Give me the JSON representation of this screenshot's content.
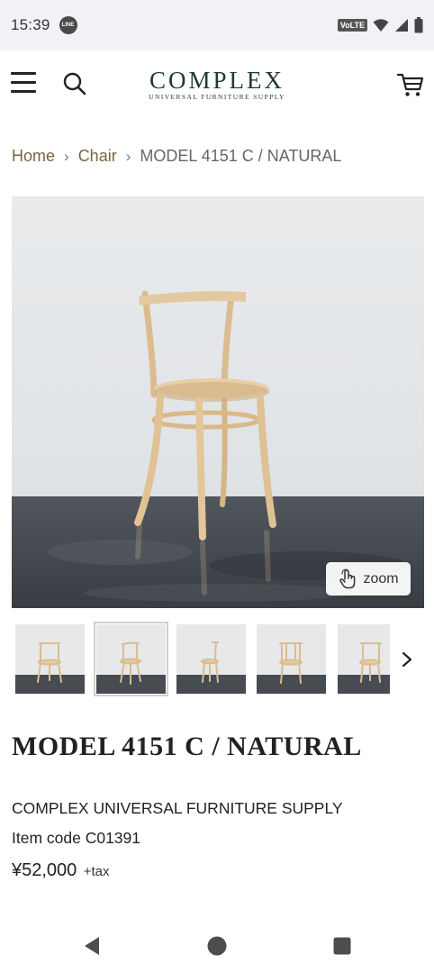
{
  "status_bar": {
    "time": "15:39",
    "line_badge": "LINE",
    "volte": "VoLTE"
  },
  "header": {
    "logo_main": "COMPLEX",
    "logo_sub": "UNIVERSAL FURNITURE SUPPLY"
  },
  "breadcrumb": {
    "items": [
      "Home",
      "Chair"
    ],
    "separator": "›",
    "current": "MODEL 4151 C / NATURAL"
  },
  "gallery": {
    "zoom_label": "zoom",
    "thumbnail_count": 5,
    "selected_index": 1
  },
  "product": {
    "title": "MODEL 4151 C / NATURAL",
    "brand": "COMPLEX UNIVERSAL FURNITURE SUPPLY",
    "item_code": "Item code C01391",
    "price": "¥52,000",
    "tax": "+tax"
  },
  "colors": {
    "brand": "#1e3a2f",
    "link": "#7a6443",
    "wall": "#e4e6e8",
    "floor": "#3d4148",
    "wood": "#e2c69c"
  },
  "icons": [
    "menu-icon",
    "search-icon",
    "cart-icon",
    "hand-pointer-icon",
    "chevron-right-icon",
    "back-icon",
    "home-icon",
    "recents-icon",
    "wifi-icon",
    "signal-icon",
    "battery-icon"
  ]
}
